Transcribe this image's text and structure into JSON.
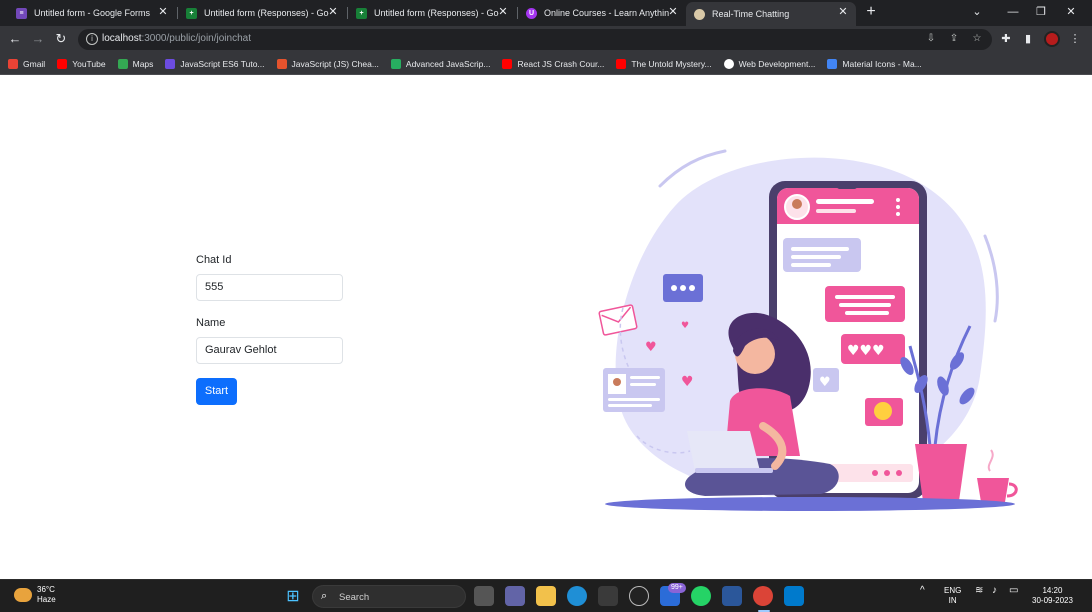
{
  "browser": {
    "tabs": [
      {
        "title": "Untitled form - Google Forms",
        "icon": "google-forms-icon",
        "color": "#7248b9"
      },
      {
        "title": "Untitled form (Responses) - Goo",
        "icon": "google-sheets-icon",
        "color": "#188038"
      },
      {
        "title": "Untitled form (Responses) - Goo",
        "icon": "google-sheets-icon",
        "color": "#188038"
      },
      {
        "title": "Online Courses - Learn Anything",
        "icon": "udemy-icon",
        "color": "#a435f0"
      },
      {
        "title": "Real-Time Chatting",
        "icon": "globe-icon",
        "color": "#d9c9a8",
        "active": true
      }
    ],
    "url_host": "localhost",
    "url_path": ":3000/public/join/joinchat",
    "bookmarks": [
      {
        "label": "Gmail",
        "color": "#ea4335"
      },
      {
        "label": "YouTube",
        "color": "#ff0000"
      },
      {
        "label": "Maps",
        "color": "#34a853"
      },
      {
        "label": "JavaScript ES6 Tuto...",
        "color": "#6c4ce0"
      },
      {
        "label": "JavaScript (JS) Chea...",
        "color": "#e5532d"
      },
      {
        "label": "Advanced JavaScrip...",
        "color": "#27ae60"
      },
      {
        "label": "React JS Crash Cour...",
        "color": "#ff0000"
      },
      {
        "label": "The Untold Mystery...",
        "color": "#ff0000"
      },
      {
        "label": "Web Development...",
        "color": "#ffffff"
      },
      {
        "label": "Material Icons - Ma...",
        "color": "#4285f4"
      }
    ]
  },
  "form": {
    "chat_id_label": "Chat Id",
    "chat_id_value": "555",
    "name_label": "Name",
    "name_value": "Gaurav Gehlot",
    "start_label": "Start"
  },
  "colors": {
    "primary": "#0d6efd",
    "illustration_pink": "#f0569a",
    "illustration_lavender": "#c9c7f0"
  },
  "taskbar": {
    "temperature": "36°C",
    "weather": "Haze",
    "search_label": "Search",
    "notification_badge": "99+",
    "language": "ENG",
    "region": "IN",
    "time": "14:20",
    "date": "30-09-2023"
  }
}
